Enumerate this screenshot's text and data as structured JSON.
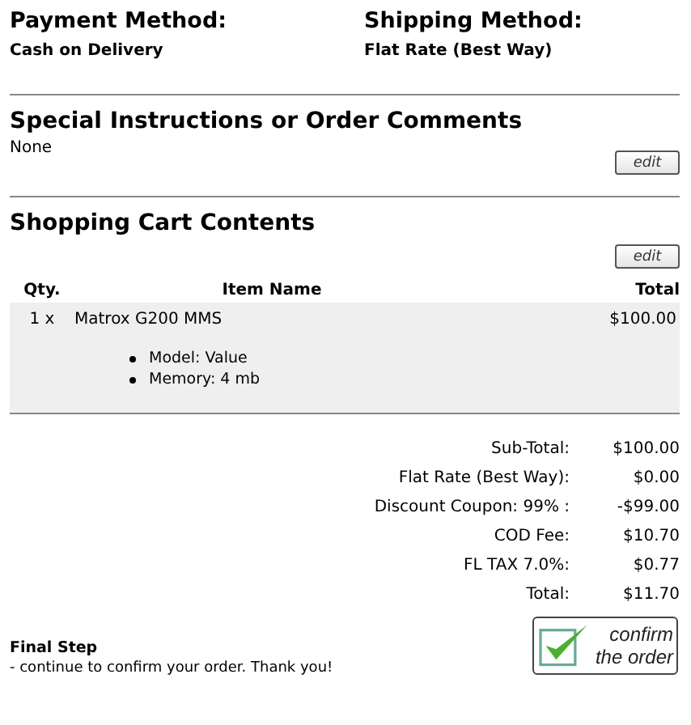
{
  "payment": {
    "label": "Payment Method:",
    "value": "Cash on Delivery"
  },
  "shipping": {
    "label": "Shipping Method:",
    "value": "Flat Rate (Best Way)"
  },
  "comments": {
    "title": "Special Instructions or Order Comments",
    "text": "None",
    "edit_button": "edit"
  },
  "cart": {
    "title": "Shopping Cart Contents",
    "edit_button": "edit",
    "columns": [
      "Qty.",
      "Item Name",
      "Total"
    ],
    "items": [
      {
        "qty": "1 x",
        "name": "Matrox G200 MMS",
        "total": "$100.00",
        "attributes": [
          "Model: Value",
          "Memory: 4 mb"
        ]
      }
    ]
  },
  "totals": [
    {
      "label": "Sub-Total:",
      "value": "$100.00"
    },
    {
      "label": "Flat Rate (Best Way):",
      "value": "$0.00"
    },
    {
      "label": "Discount Coupon: 99% :",
      "value": "-$99.00"
    },
    {
      "label": "COD Fee:",
      "value": "$10.70"
    },
    {
      "label": "FL TAX 7.0%:",
      "value": "$0.77"
    },
    {
      "label": "Total:",
      "value": "$11.70"
    }
  ],
  "final_step": {
    "title": "Final Step",
    "text": "- continue to confirm your order. Thank you!"
  },
  "confirm_button": {
    "label": "confirm the order"
  }
}
